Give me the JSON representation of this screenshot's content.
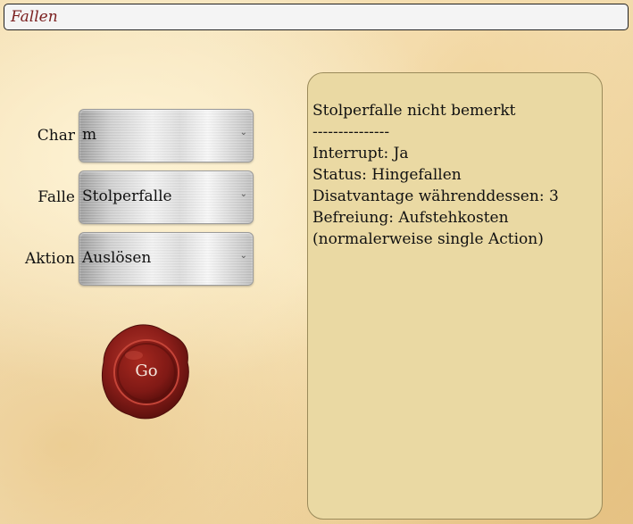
{
  "header": {
    "title": "Fallen"
  },
  "form": {
    "char": {
      "label": "Char",
      "value": "m"
    },
    "falle": {
      "label": "Falle",
      "value": "Stolperfalle"
    },
    "aktion": {
      "label": "Aktion",
      "value": "Auslösen"
    }
  },
  "go_button": {
    "label": "Go"
  },
  "info": {
    "lines": [
      "Stolperfalle nicht bemerkt",
      "---------------",
      "Interrupt: Ja",
      "Status: Hingefallen",
      "Disatvantage währenddessen: 3",
      "Befreiung: Aufstehkosten",
      "(normalerweise single Action)"
    ]
  },
  "colors": {
    "title_text": "#7a1e1e",
    "panel_bg": "#ead9a3",
    "seal": "#8e1f1a"
  },
  "icons": {
    "dropdown": "chevron-down-icon",
    "seal": "wax-seal-icon"
  }
}
